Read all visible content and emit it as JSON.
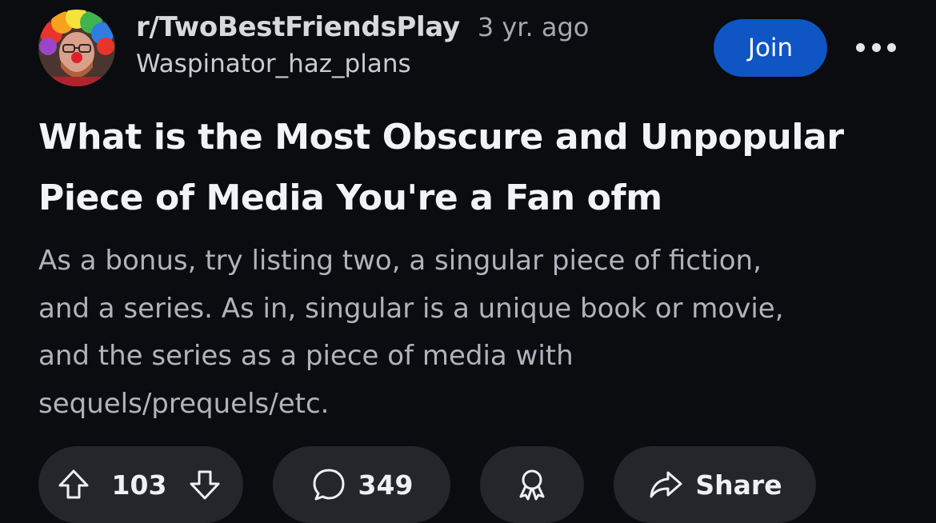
{
  "post": {
    "subreddit": "r/TwoBestFriendsPlay",
    "age": "3 yr. ago",
    "username": "Waspinator_haz_plans",
    "join_label": "Join",
    "title": "What is the Most Obscure and Unpopular Piece of Media You're a Fan ofm",
    "body_lines": [
      "As a bonus, try listing two, a singular piece of fiction,",
      "and a series. As in, singular is a unique book or movie,",
      "and the series as a piece of media with",
      "sequels/prequels/etc."
    ]
  },
  "actions": {
    "vote_count": "103",
    "comment_count": "349",
    "share_label": "Share"
  },
  "icons": {
    "more": "more-horizontal-icon",
    "upvote": "upvote-arrow-icon",
    "downvote": "downvote-arrow-icon",
    "comment": "comment-bubble-icon",
    "award": "award-icon",
    "share": "share-arrow-icon"
  },
  "colors": {
    "background": "#0b0c0f",
    "join_button": "#0f55c4",
    "pill": "#23262b",
    "body_text": "#aeb4bb"
  }
}
